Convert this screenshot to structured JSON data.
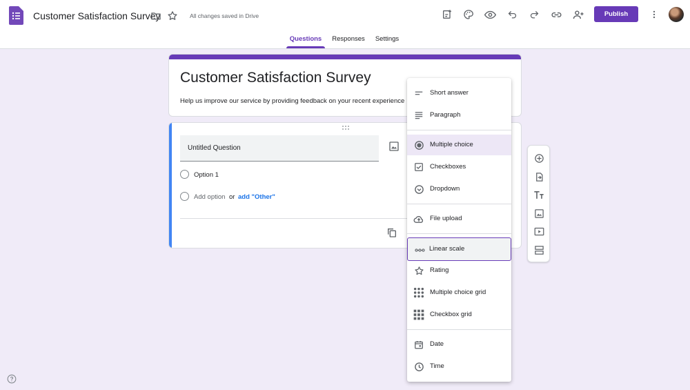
{
  "header": {
    "doc_title": "Customer Satisfaction Survey",
    "save_status": "All changes saved in Drive",
    "publish_label": "Publish",
    "icons": [
      "forms-logo-icon",
      "folder-icon",
      "star-icon",
      "addon-icon",
      "palette-icon",
      "preview-eye-icon",
      "undo-icon",
      "redo-icon",
      "link-icon",
      "add-collaborator-icon",
      "more-vert-icon"
    ],
    "accent_color": "#673ab7"
  },
  "tabs": [
    {
      "label": "Questions",
      "active": true
    },
    {
      "label": "Responses",
      "active": false
    },
    {
      "label": "Settings",
      "active": false
    }
  ],
  "form": {
    "title": "Customer Satisfaction Survey",
    "description": "Help us improve our service by providing feedback on your recent experience"
  },
  "question": {
    "title_value": "Untitled Question",
    "options": [
      "Option 1"
    ],
    "add_option_label": "Add option",
    "or_label": "or",
    "add_other_label": "add \"Other\""
  },
  "question_type_menu": {
    "items": [
      {
        "label": "Short answer",
        "icon": "short-answer-icon"
      },
      {
        "label": "Paragraph",
        "icon": "paragraph-icon"
      },
      {
        "label": "Multiple choice",
        "icon": "radio-button-icon",
        "selected": true
      },
      {
        "label": "Checkboxes",
        "icon": "checkbox-icon"
      },
      {
        "label": "Dropdown",
        "icon": "dropdown-circle-icon"
      },
      {
        "label": "File upload",
        "icon": "cloud-upload-icon"
      },
      {
        "label": "Linear scale",
        "icon": "linear-scale-icon",
        "hovered": true
      },
      {
        "label": "Rating",
        "icon": "star-outline-icon"
      },
      {
        "label": "Multiple choice grid",
        "icon": "dot-grid-icon"
      },
      {
        "label": "Checkbox grid",
        "icon": "square-grid-icon"
      },
      {
        "label": "Date",
        "icon": "calendar-icon"
      },
      {
        "label": "Time",
        "icon": "clock-icon"
      }
    ]
  },
  "side_toolbar": {
    "icons": [
      "add-question-icon",
      "import-questions-icon",
      "add-title-icon",
      "add-image-icon",
      "add-video-icon",
      "add-section-icon"
    ]
  }
}
